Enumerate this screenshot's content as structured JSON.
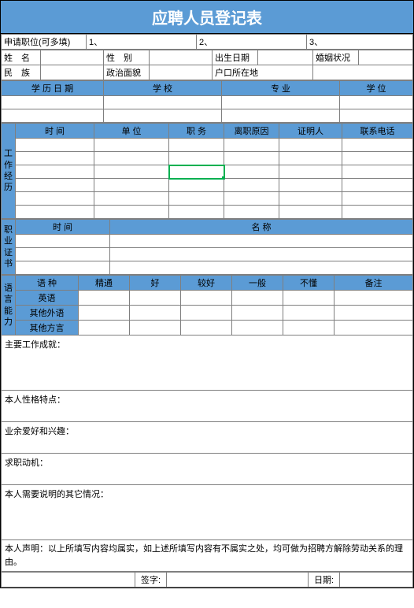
{
  "title": "应聘人员登记表",
  "apply": {
    "label": "申请职位(可多填)",
    "v1": "1、",
    "v2": "2、",
    "v3": "3、"
  },
  "basic": {
    "name": "姓   名",
    "gender": "性   别",
    "birth": "出生日期",
    "marriage": "婚姻状况",
    "ethnic": "民   族",
    "political": "政治面貌",
    "huji": "户口所在地"
  },
  "edu": {
    "date": "学 历 日 期",
    "school": "学   校",
    "major": "专   业",
    "degree": "学   位"
  },
  "work": {
    "group": "工作经历",
    "time": "时   间",
    "unit": "单   位",
    "job": "职   务",
    "reason": "离职原因",
    "ref": "证明人",
    "phone": "联系电话"
  },
  "cert": {
    "group": "职业证书",
    "time": "时   间",
    "name": "名   称"
  },
  "lang": {
    "group": "语言能力",
    "type": "语   种",
    "c1": "精通",
    "c2": "好",
    "c3": "较好",
    "c4": "一般",
    "c5": "不懂",
    "c6": "备注",
    "r1": "英语",
    "r2": "其他外语",
    "r3": "其他方言"
  },
  "text": {
    "achieve": "主要工作成就：",
    "personality": "本人性格特点：",
    "hobby": "业余爱好和兴趣：",
    "motive": "求职动机：",
    "other": "本人需要说明的其它情况：",
    "declare": "本人声明：以上所填写内容均属实，如上述所填写内容有不属实之处，均可做为招聘方解除劳动关系的理由。",
    "sign": "签字:",
    "date": "日期:"
  }
}
